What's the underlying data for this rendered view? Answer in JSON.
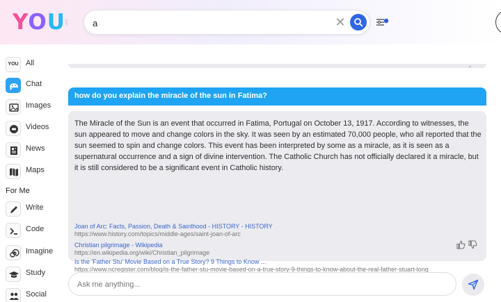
{
  "brand": {
    "logo_y": "Y",
    "logo_o": "O",
    "logo_u": "U",
    "logo_sub": ".com"
  },
  "search": {
    "value": "a",
    "clear_glyph": "✕"
  },
  "sidebar": {
    "items": [
      {
        "label": "All",
        "icon": "you-logo-icon"
      },
      {
        "label": "Chat",
        "icon": "chat-icon"
      },
      {
        "label": "Images",
        "icon": "image-icon"
      },
      {
        "label": "Videos",
        "icon": "video-icon"
      },
      {
        "label": "News",
        "icon": "news-icon"
      },
      {
        "label": "Maps",
        "icon": "map-icon"
      }
    ],
    "section_label": "For Me",
    "me_items": [
      {
        "label": "Write",
        "icon": "pencil-icon"
      },
      {
        "label": "Code",
        "icon": "terminal-icon"
      },
      {
        "label": "Imagine",
        "icon": "spiral-icon"
      },
      {
        "label": "Study",
        "icon": "graduation-cap-icon"
      },
      {
        "label": "Social",
        "icon": "people-icon"
      }
    ],
    "you_icon_text": "YOU"
  },
  "chat": {
    "query": "how do you explain the miracle of the sun in Fatima?",
    "answer": "The Miracle of the Sun is an event that occurred in Fatima, Portugal on October 13, 1917. According to witnesses, the sun appeared to move and change colors in the sky. It was seen by an estimated 70,000 people, who all reported that the sun seemed to spin and change colors. This event has been interpreted by some as a miracle, as it is seen as a supernatural occurrence and a sign of divine intervention. The Catholic Church has not officially declared it a miracle, but it is still considered to be a significant event in Catholic history.",
    "sources": [
      {
        "title": "Joan of Arc: Facts, Passion, Death & Sainthood - HISTORY - HISTORY",
        "url": "https://www.history.com/topics/middle-ages/saint-joan-of-arc"
      },
      {
        "title": "Christian pilgrimage - Wikipedia",
        "url": "https://en.wikipedia.org/wiki/Christian_pilgrimage"
      },
      {
        "title": "Is the 'Father Stu' Movie Based on a True Story? 9 Things to Know ...",
        "url": "https://www.ncregister.com/blog/is-the-father-stu-movie-based-on-a-true-story-9-things-to-know-about-the-real-father-stuart-long"
      }
    ]
  },
  "composer": {
    "placeholder": "Ask me anything..."
  },
  "colors": {
    "accent": "#1ea4f2",
    "search_button": "#2f66e6",
    "link": "#3a64c8"
  }
}
